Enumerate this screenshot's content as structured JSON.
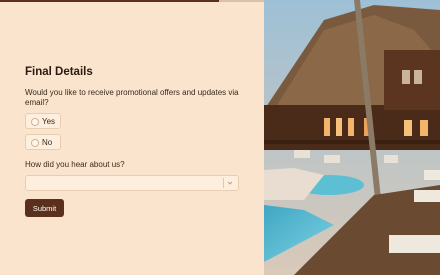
{
  "form": {
    "title": "Final Details",
    "progress": 0.83,
    "question_promo": "Would you like to receive promotional offers and updates via email?",
    "options": [
      {
        "label": "Yes",
        "selected": false
      },
      {
        "label": "No",
        "selected": false
      }
    ],
    "question_source": "How did you hear about us?",
    "source_select": {
      "value": ""
    },
    "submit_label": "Submit"
  },
  "colors": {
    "background": "#fbe4cd",
    "accent": "#5a2f1c"
  },
  "image": {
    "subject": "resort-building-with-pool"
  }
}
